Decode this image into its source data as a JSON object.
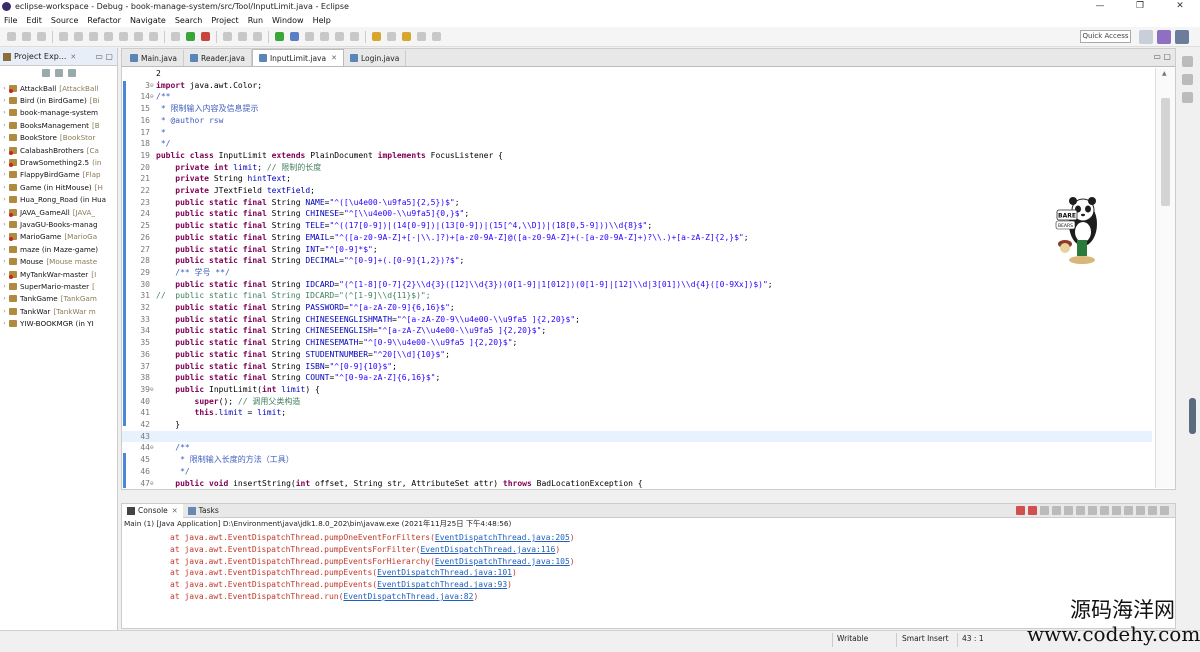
{
  "window": {
    "title": "eclipse-workspace - Debug - book-manage-system/src/Tool/InputLimit.java - Eclipse",
    "buttons": [
      "—",
      "❐",
      "✕"
    ]
  },
  "menu": [
    "File",
    "Edit",
    "Source",
    "Refactor",
    "Navigate",
    "Search",
    "Project",
    "Run",
    "Window",
    "Help"
  ],
  "toolbar": {
    "quick_access": "Quick Access"
  },
  "project_explorer": {
    "title": "Project Exp...",
    "items": [
      {
        "name": "AttackBall",
        "extra": "[AttackBall",
        "error": true
      },
      {
        "name": "Bird (in BirdGame)",
        "extra": "[Bi",
        "error": false
      },
      {
        "name": "book-manage-system",
        "extra": "",
        "error": false
      },
      {
        "name": "BooksManagement",
        "extra": "[B",
        "error": false
      },
      {
        "name": "BookStore",
        "extra": "[BookStor",
        "error": false
      },
      {
        "name": "CalabashBrothers",
        "extra": "[Ca",
        "error": true
      },
      {
        "name": "DrawSomething2.5",
        "extra": "(in",
        "error": true
      },
      {
        "name": "FlappyBirdGame",
        "extra": "[Flap",
        "error": false
      },
      {
        "name": "Game (in HitMouse)",
        "extra": "[H",
        "error": false
      },
      {
        "name": "Hua_Rong_Road (in Hua",
        "extra": "",
        "error": false
      },
      {
        "name": "JAVA_GameAll",
        "extra": "[JAVA_",
        "error": true
      },
      {
        "name": "JavaGU-Books-manag",
        "extra": "",
        "error": false
      },
      {
        "name": "MarioGame",
        "extra": "[MarioGa",
        "error": true
      },
      {
        "name": "maze (in Maze-game)",
        "extra": "",
        "error": false
      },
      {
        "name": "Mouse",
        "extra": "[Mouse maste",
        "error": false
      },
      {
        "name": "MyTankWar-master",
        "extra": "[I",
        "error": true
      },
      {
        "name": "SuperMario-master",
        "extra": "[",
        "error": false
      },
      {
        "name": "TankGame",
        "extra": "[TankGam",
        "error": false
      },
      {
        "name": "TankWar",
        "extra": "[TankWar m",
        "error": false
      },
      {
        "name": "YIW-BOOKMGR (in YI",
        "extra": "",
        "error": false
      }
    ]
  },
  "editor": {
    "tabs": [
      {
        "label": "Main.java",
        "active": false
      },
      {
        "label": "Reader.java",
        "active": false
      },
      {
        "label": "InputLimit.java",
        "active": true
      },
      {
        "label": "Login.java",
        "active": false
      }
    ],
    "lines": [
      {
        "n": "",
        "t": "2"
      },
      {
        "n": "3",
        "t": "import java.awt.Color;",
        "fold": true
      },
      {
        "n": "14",
        "t": "/**",
        "fold": true
      },
      {
        "n": "15",
        "t": " * 限制输入内容及信息提示"
      },
      {
        "n": "16",
        "t": " * @author rsw"
      },
      {
        "n": "17",
        "t": " *"
      },
      {
        "n": "18",
        "t": " */"
      },
      {
        "n": "19",
        "t": "public class InputLimit extends PlainDocument implements FocusListener {"
      },
      {
        "n": "20",
        "t": "    private int limit; // 限制的长度"
      },
      {
        "n": "21",
        "t": "    private String hintText;"
      },
      {
        "n": "22",
        "t": "    private JTextField textField;"
      },
      {
        "n": "23",
        "t": "    public static final String NAME=\"^([\\u4e00-\\u9fa5]{2,5})$\";"
      },
      {
        "n": "24",
        "t": "    public static final String CHINESE=\"^[\\\\u4e00-\\\\u9fa5]{0,}$\";"
      },
      {
        "n": "25",
        "t": "    public static final String TELE=\"^((17[0-9])|(14[0-9])|(13[0-9])|(15[^4,\\\\D])|(18[0,5-9]))\\\\d{8}$\";"
      },
      {
        "n": "26",
        "t": "    public static final String EMAIL=\"^([a-z0-9A-Z]+[-|\\\\.]?)+[a-z0-9A-Z]@([a-z0-9A-Z]+(-[a-z0-9A-Z]+)?\\\\.)+[a-zA-Z]{2,}$\";"
      },
      {
        "n": "27",
        "t": "    public static final String INT=\"^[0-9]*$\";"
      },
      {
        "n": "28",
        "t": "    public static final String DECIMAL=\"^[0-9]+(.[0-9]{1,2})?$\";"
      },
      {
        "n": "29",
        "t": "    /** 学号 **/"
      },
      {
        "n": "30",
        "t": "    public static final String IDCARD=\"(^[1-8][0-7]{2}\\\\d{3}([12]\\\\d{3})(0[1-9]|1[012])(0[1-9]|[12]\\\\d|3[01])\\\\d{4}([0-9Xx])$)\";"
      },
      {
        "n": "31",
        "t": "//  public static final String IDCARD=\"(^[1-9]\\\\d{11}$)\";"
      },
      {
        "n": "32",
        "t": "    public static final String PASSWORD=\"^[a-zA-Z0-9]{6,16}$\";"
      },
      {
        "n": "33",
        "t": "    public static final String CHINESEENGLISHMATH=\"^[a-zA-Z0-9\\\\u4e00-\\\\u9fa5 ]{2,20}$\";"
      },
      {
        "n": "34",
        "t": "    public static final String CHINESEENGLISH=\"^[a-zA-Z\\\\u4e00-\\\\u9fa5 ]{2,20}$\";"
      },
      {
        "n": "35",
        "t": "    public static final String CHINESEMATH=\"^[0-9\\\\u4e00-\\\\u9fa5 ]{2,20}$\";"
      },
      {
        "n": "36",
        "t": "    public static final String STUDENTNUMBER=\"^20[\\\\d]{10}$\";"
      },
      {
        "n": "37",
        "t": "    public static final String ISBN=\"^[0-9]{10}$\";"
      },
      {
        "n": "38",
        "t": "    public static final String COUNT=\"^[0-9a-zA-Z]{6,16}$\";"
      },
      {
        "n": "39",
        "t": "    public InputLimit(int limit) {",
        "fold": true
      },
      {
        "n": "40",
        "t": "        super(); // 调用父类构造"
      },
      {
        "n": "41",
        "t": "        this.limit = limit;"
      },
      {
        "n": "42",
        "t": "    }"
      },
      {
        "n": "43",
        "t": "",
        "cursor": true
      },
      {
        "n": "44",
        "t": "    /**",
        "fold": true
      },
      {
        "n": "45",
        "t": "     * 限制输入长度的方法（工具）"
      },
      {
        "n": "46",
        "t": "     */"
      },
      {
        "n": "47",
        "t": "    public void insertString(int offset, String str, AttributeSet attr) throws BadLocationException {",
        "fold": true
      }
    ]
  },
  "console": {
    "tabs": [
      {
        "label": "Console",
        "active": true
      },
      {
        "label": "Tasks",
        "active": false
      }
    ],
    "description": "Main (1) [Java Application] D:\\Environment\\java\\jdk1.8.0_202\\bin\\javaw.exe (2021年11月25日 下午4:48:56)",
    "lines": [
      {
        "text": "at java.awt.EventDispatchThread.pumpOneEventForFilters(",
        "link": "EventDispatchThread.java:205",
        "end": ")"
      },
      {
        "text": "at java.awt.EventDispatchThread.pumpEventsForFilter(",
        "link": "EventDispatchThread.java:116",
        "end": ")"
      },
      {
        "text": "at java.awt.EventDispatchThread.pumpEventsForHierarchy(",
        "link": "EventDispatchThread.java:105",
        "end": ")"
      },
      {
        "text": "at java.awt.EventDispatchThread.pumpEvents(",
        "link": "EventDispatchThread.java:101",
        "end": ")"
      },
      {
        "text": "at java.awt.EventDispatchThread.pumpEvents(",
        "link": "EventDispatchThread.java:93",
        "end": ")"
      },
      {
        "text": "at java.awt.EventDispatchThread.run(",
        "link": "EventDispatchThread.java:82",
        "end": ")"
      }
    ]
  },
  "statusbar": {
    "writable": "Writable",
    "insert_mode": "Smart Insert",
    "position": "43 : 1"
  },
  "watermark": {
    "line1": "源码海洋网",
    "line2": "www.codehy.com"
  },
  "sticker": {
    "brand": "BARE",
    "brand2": "BEARS"
  },
  "colors": {
    "keyword": "#7f0055",
    "string": "#2a00ff",
    "comment": "#3f7f5f",
    "javadoc": "#3f5fbf",
    "field": "#0000c0",
    "console_error": "#c0392b",
    "link": "#1f5fbf"
  }
}
